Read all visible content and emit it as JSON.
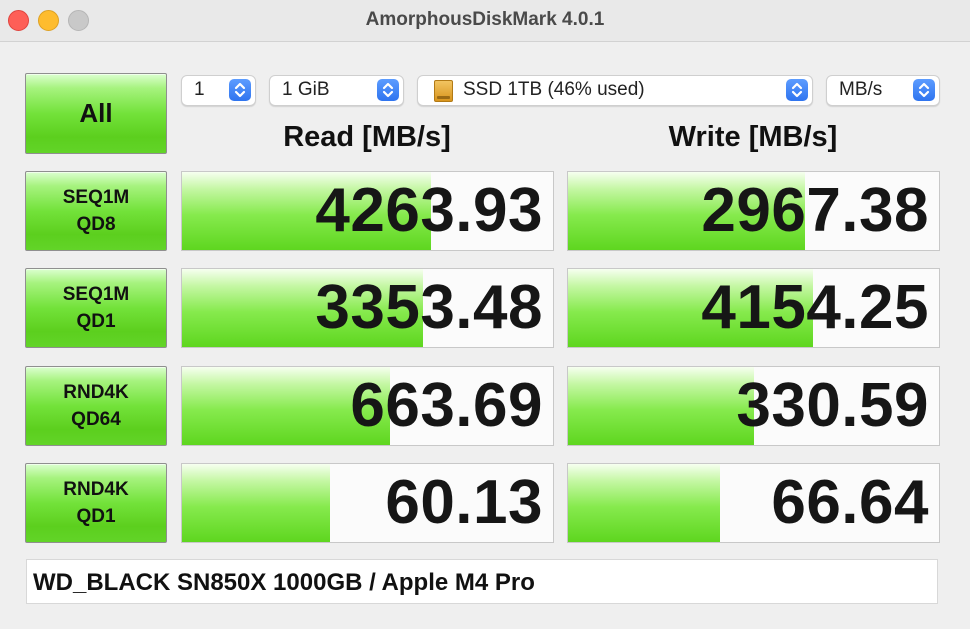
{
  "window": {
    "title": "AmorphousDiskMark 4.0.1"
  },
  "controls": {
    "count": "1",
    "size": "1 GiB",
    "drive": "SSD 1TB (46% used)",
    "unit": "MB/s"
  },
  "buttons": {
    "all": "All",
    "tests": [
      {
        "line1": "SEQ1M",
        "line2": "QD8"
      },
      {
        "line1": "SEQ1M",
        "line2": "QD1"
      },
      {
        "line1": "RND4K",
        "line2": "QD64"
      },
      {
        "line1": "RND4K",
        "line2": "QD1"
      }
    ]
  },
  "headers": {
    "read": "Read [MB/s]",
    "write": "Write [MB/s]"
  },
  "results": [
    {
      "read": "4263.93",
      "write": "2967.38",
      "read_fill": 0.67,
      "write_fill": 0.64
    },
    {
      "read": "3353.48",
      "write": "4154.25",
      "read_fill": 0.65,
      "write_fill": 0.66
    },
    {
      "read": "663.69",
      "write": "330.59",
      "read_fill": 0.56,
      "write_fill": 0.5
    },
    {
      "read": "60.13",
      "write": "66.64",
      "read_fill": 0.4,
      "write_fill": 0.41
    }
  ],
  "footer": {
    "text": "WD_BLACK SN850X 1000GB / Apple M4 Pro"
  }
}
